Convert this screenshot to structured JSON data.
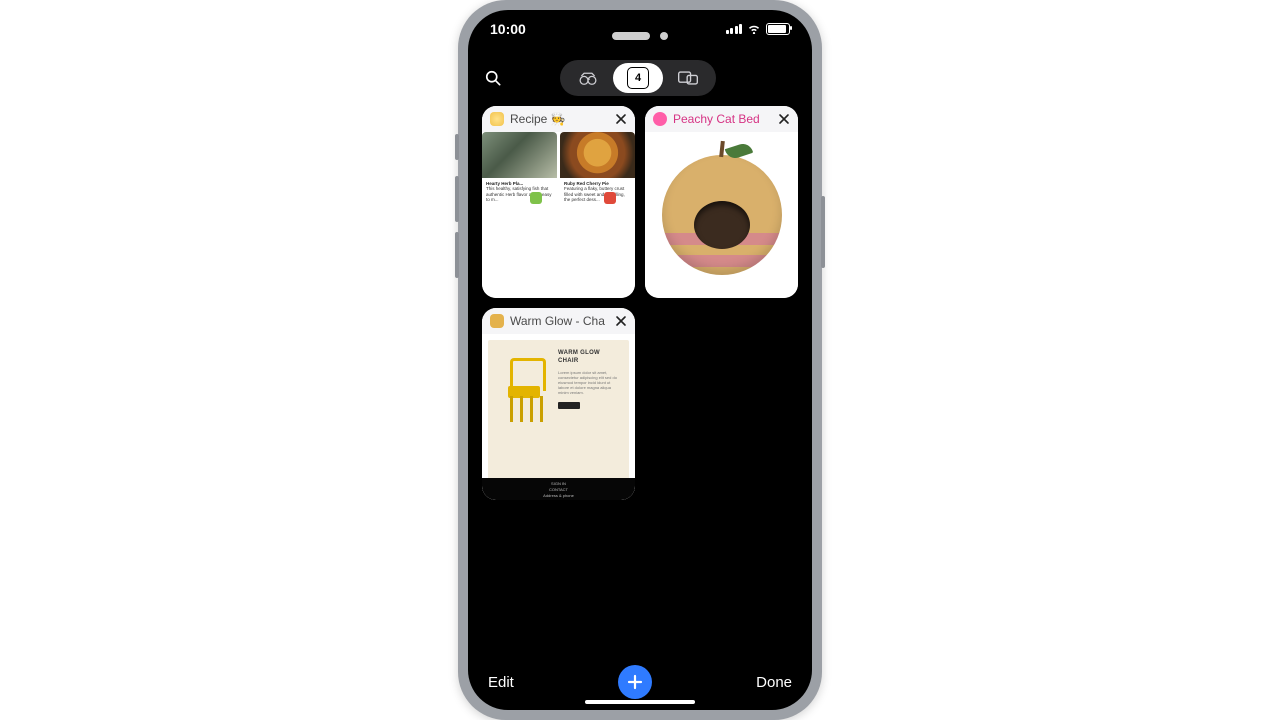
{
  "status": {
    "time": "10:00"
  },
  "segmented": {
    "tab_count": "4"
  },
  "tabs": [
    {
      "title": "Recipe 🧑‍🍳",
      "favicon": "fav-yellow",
      "title_class": "",
      "recipe": {
        "card1_title": "Hearty Herb Pla...",
        "card1_desc": "This healthy, satisfying fish that authentic Herb flavor and is easy to m...",
        "card2_title": "Ruby Red Cherry Pie",
        "card2_desc": "Featuring a flaky, buttery crust filled with sweet and tart filling, the perfect dess..."
      }
    },
    {
      "title": "Peachy Cat Bed",
      "favicon": "fav-pink",
      "title_class": "pink"
    },
    {
      "title": "Warm Glow - Cha",
      "favicon": "fav-gold",
      "title_class": "",
      "product": {
        "heading": "WARM GLOW CHAIR",
        "para": "Lorem ipsum dolor sit amet, consectetur adipiscing elit sed do eiusmod tempor incid idunt ut labore et dolore magna aliqua minim veniam.",
        "footer1": "SIGN IN",
        "footer2": "CONTACT",
        "footer3": "Address & phone"
      }
    }
  ],
  "bottom": {
    "edit": "Edit",
    "done": "Done"
  }
}
